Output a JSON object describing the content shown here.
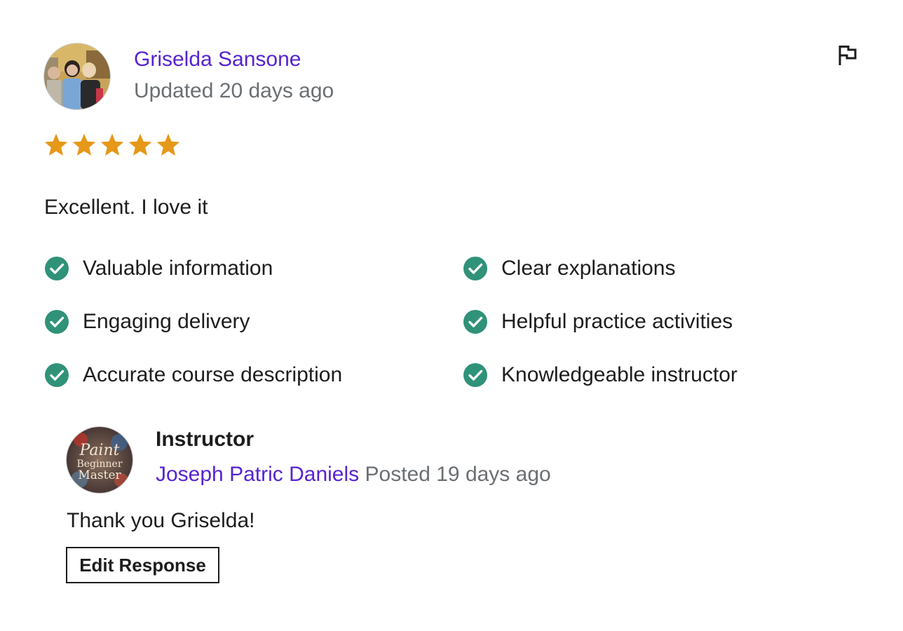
{
  "review": {
    "reviewer_name": "Griselda Sansone",
    "updated_text": "Updated 20 days ago",
    "rating": 5,
    "rating_max": 5,
    "star_color": "#e59819",
    "text": "Excellent. I love it",
    "flag_icon": "flag-icon"
  },
  "feedback_tags": [
    {
      "label": "Valuable information",
      "icon": "check-circle-icon"
    },
    {
      "label": "Clear explanations",
      "icon": "check-circle-icon"
    },
    {
      "label": "Engaging delivery",
      "icon": "check-circle-icon"
    },
    {
      "label": "Helpful practice activities",
      "icon": "check-circle-icon"
    },
    {
      "label": "Accurate course description",
      "icon": "check-circle-icon"
    },
    {
      "label": "Knowledgeable instructor",
      "icon": "check-circle-icon"
    }
  ],
  "response": {
    "role": "Instructor",
    "instructor_name": "Joseph Patric Daniels",
    "posted_text": "Posted 19 days ago",
    "text": "Thank you Griselda!",
    "edit_label": "Edit Response",
    "avatar_text": [
      "Paint",
      "Beginner",
      "Master"
    ]
  },
  "colors": {
    "link": "#5624d0",
    "muted": "#6a6f73",
    "text": "#1c1d1f",
    "check": "#2f9279"
  }
}
